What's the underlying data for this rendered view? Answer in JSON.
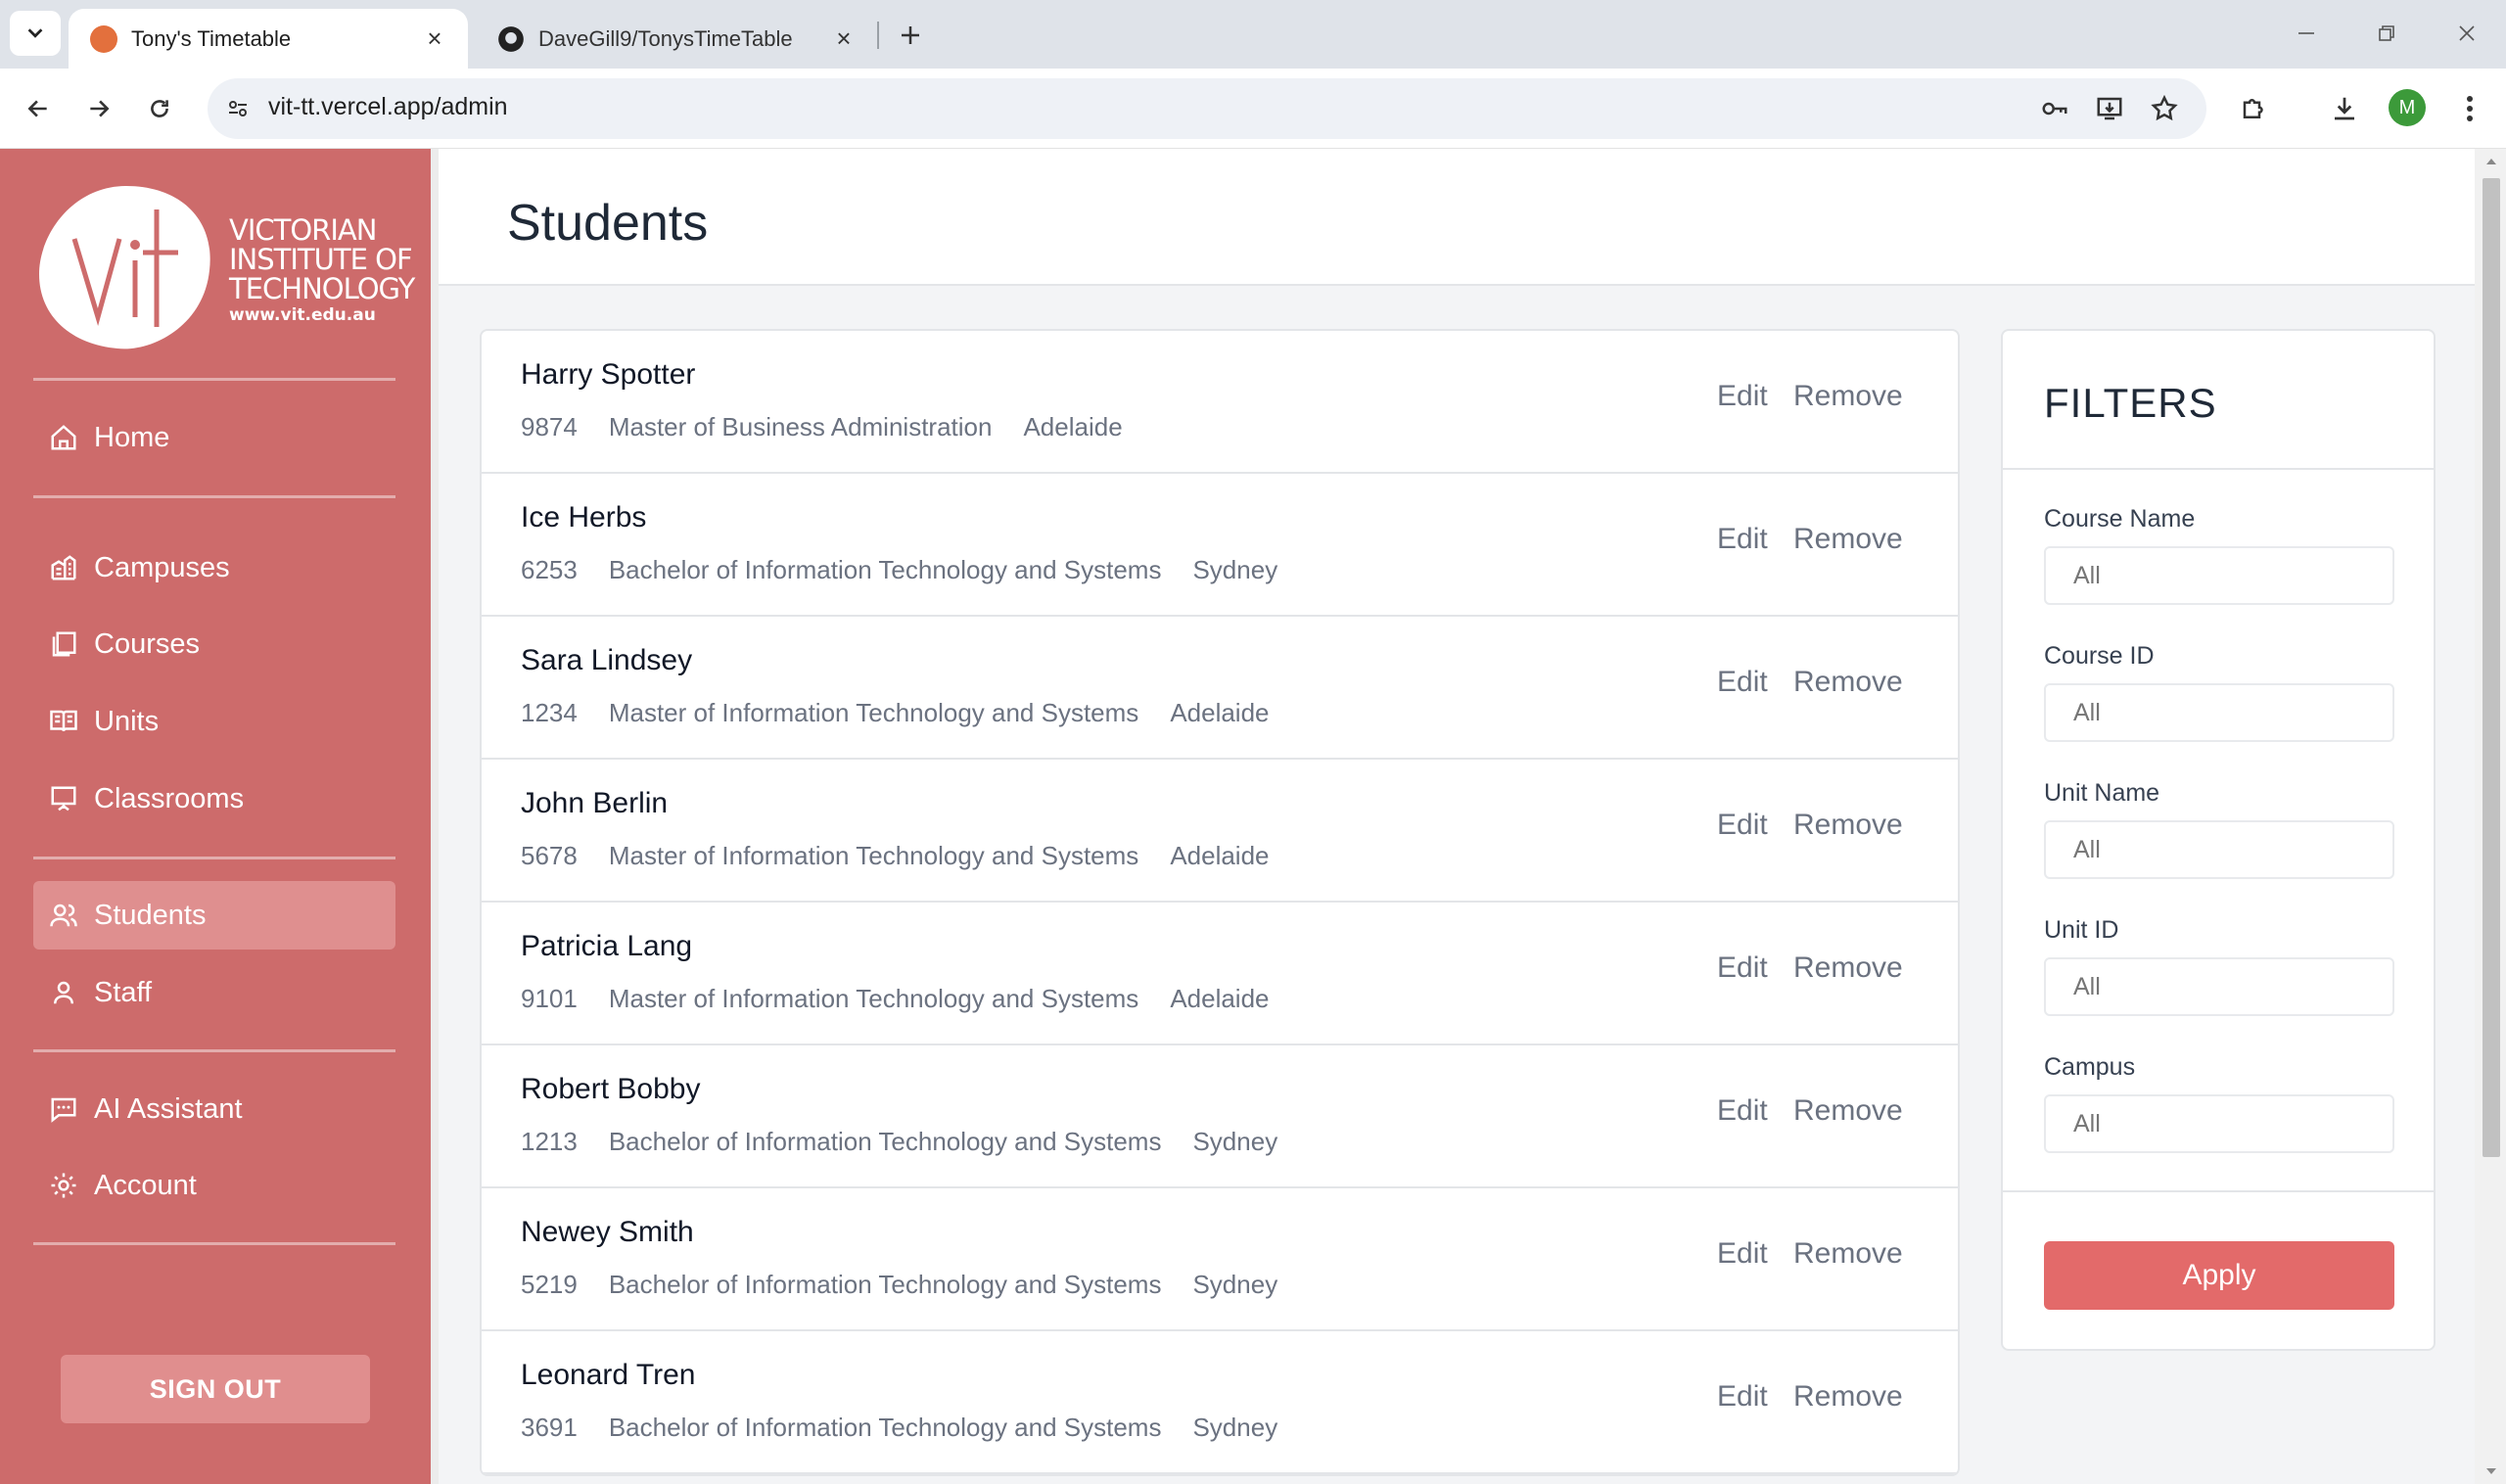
{
  "browser": {
    "tabs": [
      {
        "title": "Tony's Timetable",
        "active": true
      },
      {
        "title": "DaveGill9/TonysTimeTable",
        "active": false
      }
    ],
    "url": "vit-tt.vercel.app/admin",
    "profile_initial": "M"
  },
  "sidebar": {
    "logo": {
      "line1": "VICTORIAN",
      "line2": "INSTITUTE OF",
      "line3": "TECHNOLOGY",
      "website": "www.vit.edu.au"
    },
    "items": [
      {
        "label": "Home",
        "icon": "home-icon"
      },
      {
        "label": "Campuses",
        "icon": "campus-icon"
      },
      {
        "label": "Courses",
        "icon": "courses-icon"
      },
      {
        "label": "Units",
        "icon": "book-icon"
      },
      {
        "label": "Classrooms",
        "icon": "presentation-icon"
      },
      {
        "label": "Students",
        "icon": "users-icon",
        "active": true
      },
      {
        "label": "Staff",
        "icon": "user-icon"
      },
      {
        "label": "AI Assistant",
        "icon": "chat-icon"
      },
      {
        "label": "Account",
        "icon": "gear-icon"
      }
    ],
    "sign_out": "SIGN OUT"
  },
  "main": {
    "title": "Students",
    "actions": {
      "edit": "Edit",
      "remove": "Remove"
    },
    "students": [
      {
        "name": "Harry Spotter",
        "id": "9874",
        "course": "Master of Business Administration",
        "campus": "Adelaide"
      },
      {
        "name": "Ice Herbs",
        "id": "6253",
        "course": "Bachelor of Information Technology and Systems",
        "campus": "Sydney"
      },
      {
        "name": "Sara Lindsey",
        "id": "1234",
        "course": "Master of Information Technology and Systems",
        "campus": "Adelaide"
      },
      {
        "name": "John Berlin",
        "id": "5678",
        "course": "Master of Information Technology and Systems",
        "campus": "Adelaide"
      },
      {
        "name": "Patricia Lang",
        "id": "9101",
        "course": "Master of Information Technology and Systems",
        "campus": "Adelaide"
      },
      {
        "name": "Robert Bobby",
        "id": "1213",
        "course": "Bachelor of Information Technology and Systems",
        "campus": "Sydney"
      },
      {
        "name": "Newey Smith",
        "id": "5219",
        "course": "Bachelor of Information Technology and Systems",
        "campus": "Sydney"
      },
      {
        "name": "Leonard Tren",
        "id": "3691",
        "course": "Bachelor of Information Technology and Systems",
        "campus": "Sydney"
      }
    ]
  },
  "filters": {
    "title": "FILTERS",
    "fields": [
      {
        "label": "Course Name",
        "placeholder": "All"
      },
      {
        "label": "Course ID",
        "placeholder": "All"
      },
      {
        "label": "Unit Name",
        "placeholder": "All"
      },
      {
        "label": "Unit ID",
        "placeholder": "All"
      },
      {
        "label": "Campus",
        "placeholder": "All"
      }
    ],
    "apply": "Apply"
  },
  "colors": {
    "sidebar": "#cd6b6b",
    "sidebar_active": "#df8f8f",
    "apply_button": "#e36a6a"
  }
}
